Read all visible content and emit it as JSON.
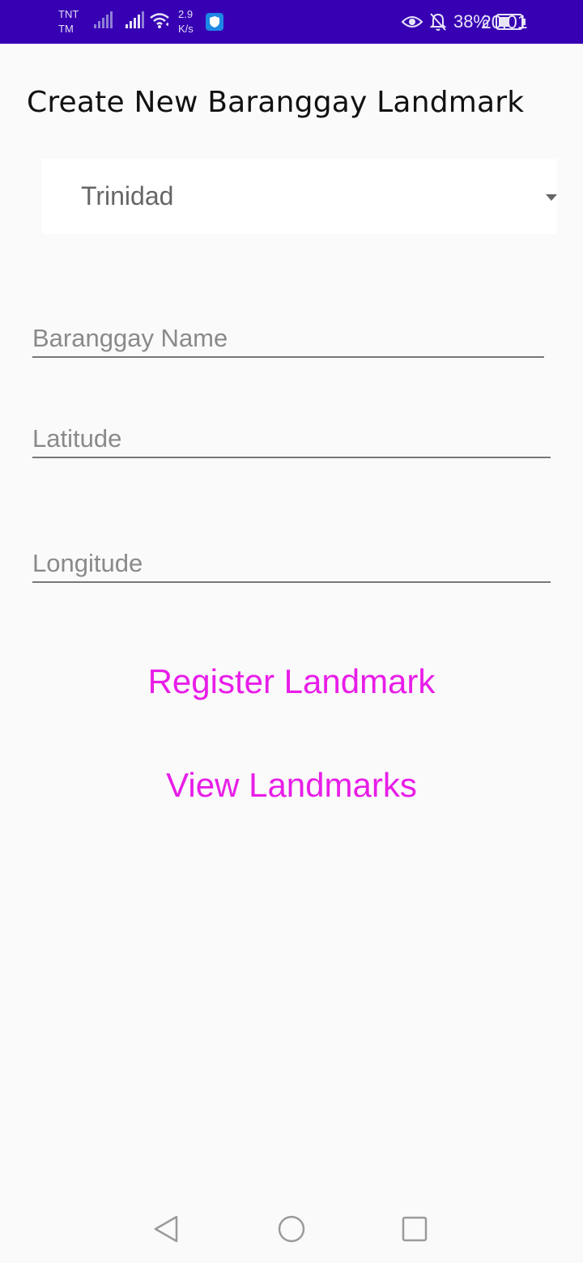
{
  "status_bar": {
    "carrier_line1": "TNT",
    "carrier_line2": "TM",
    "speed_value": "2.9",
    "speed_unit": "K/s",
    "battery": "38%",
    "time": "20:01",
    "background_color": "#3700b3"
  },
  "page": {
    "title": "Create New Baranggay Landmark"
  },
  "spinner": {
    "selected": "Trinidad"
  },
  "form": {
    "barangay_placeholder": "Baranggay Name",
    "latitude_placeholder": "Latitude",
    "longitude_placeholder": "Longitude"
  },
  "actions": {
    "register_label": "Register Landmark",
    "view_label": "View Landmarks",
    "accent_color": "#e81de8"
  },
  "nav": {
    "back_icon": "back-triangle-icon",
    "home_icon": "home-circle-icon",
    "recents_icon": "recents-square-icon"
  }
}
